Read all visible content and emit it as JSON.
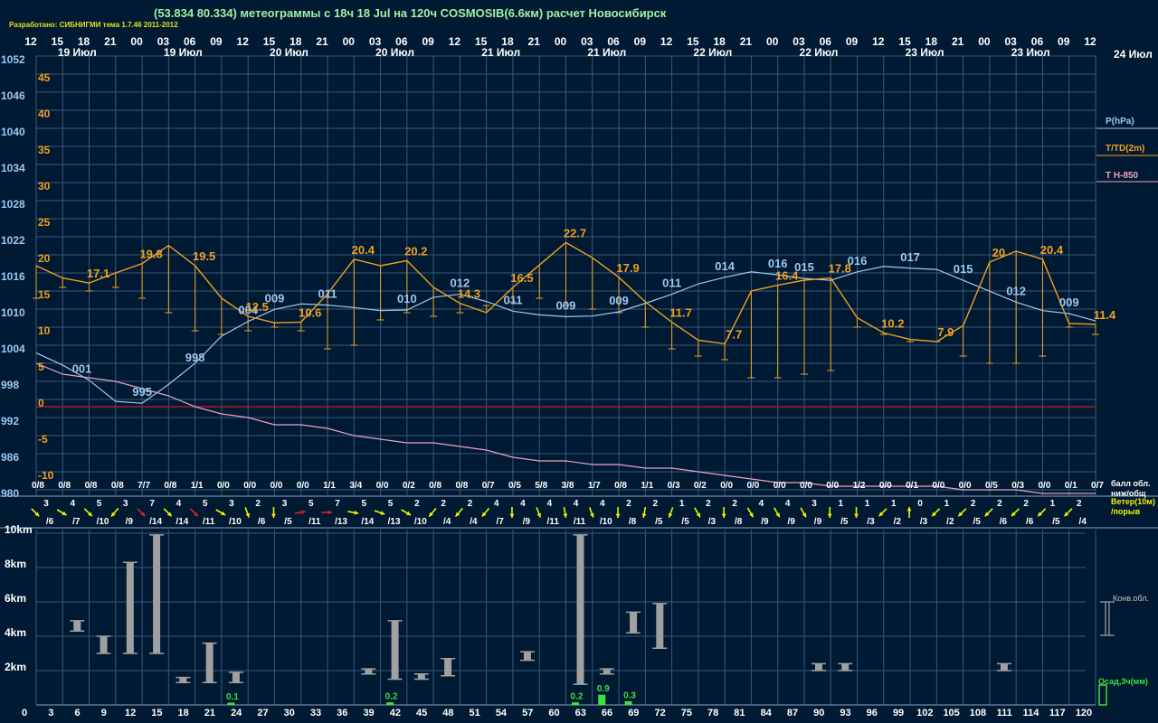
{
  "header": {
    "title": "(53.834 80.334) метеограммы с  18ч 18 Jul на 120ч COSMOSIB(6.6км) расчет Новосибирск",
    "credit": "Разработано: СИБНИГМИ тема 1.7.46 2011-2012"
  },
  "colors": {
    "background": "#001a33",
    "grid": "#3a5878",
    "pressure": "#9ec8f0",
    "temperature": "#f0a020",
    "t850": "#f0a0c0",
    "zero_line": "#c02020",
    "wind": "#f0f000",
    "wind_strong": "#e02020",
    "cloud": "#a0a0a0",
    "precip": "#40e040"
  },
  "time_axis": {
    "hours": [
      "12",
      "15",
      "18",
      "21",
      "00",
      "03",
      "06",
      "09",
      "12",
      "15",
      "18",
      "21",
      "00",
      "03",
      "06",
      "09",
      "12",
      "15",
      "18",
      "21",
      "00",
      "03",
      "06",
      "09",
      "12",
      "15",
      "18",
      "21",
      "00",
      "03",
      "06",
      "09",
      "12",
      "15",
      "18",
      "21",
      "00",
      "03",
      "06",
      "09",
      "12"
    ],
    "dates": [
      "19 Июл",
      "19 Июл",
      "20 Июл",
      "20 Июл",
      "21 Июл",
      "21 Июл",
      "22 Июл",
      "22 Июл",
      "23 Июл",
      "23 Июл"
    ],
    "right_date": "24 Июл",
    "lead_hours": [
      "0",
      "3",
      "6",
      "9",
      "12",
      "15",
      "18",
      "21",
      "24",
      "27",
      "30",
      "33",
      "36",
      "39",
      "42",
      "45",
      "48",
      "51",
      "54",
      "57",
      "60",
      "63",
      "66",
      "69",
      "72",
      "75",
      "78",
      "81",
      "84",
      "87",
      "90",
      "93",
      "96",
      "99",
      "102",
      "105",
      "108",
      "111",
      "114",
      "117",
      "120"
    ]
  },
  "pressure_axis": [
    "1052",
    "1046",
    "1040",
    "1034",
    "1028",
    "1022",
    "1016",
    "1010",
    "1004",
    "998",
    "992",
    "986",
    "980"
  ],
  "temp_axis": [
    "45",
    "40",
    "35",
    "30",
    "25",
    "20",
    "15",
    "10",
    "5",
    "0",
    "-5",
    "-10"
  ],
  "height_axis": [
    "10km",
    "8km",
    "6km",
    "4km",
    "2km"
  ],
  "legend": {
    "pressure": "P(hPa)",
    "temperature": "T/TD(2m)",
    "t850": "T H-850",
    "cloud_label": "балл обл.\nниж/общ",
    "wind_label": "Ветер(10м)\n/порыв",
    "conv_label": "Конв.обл.",
    "precip_label": "Осад,3ч(мм)"
  },
  "chart_data": {
    "type": "line",
    "lead_hours": [
      0,
      3,
      6,
      9,
      12,
      15,
      18,
      21,
      24,
      27,
      30,
      33,
      36,
      39,
      42,
      45,
      48,
      51,
      54,
      57,
      60,
      63,
      66,
      69,
      72,
      75,
      78,
      81,
      84,
      87,
      90,
      93,
      96,
      99,
      102,
      105,
      108,
      111,
      114,
      117,
      120
    ],
    "pressure_hpa": [
      1003.2,
      1001.2,
      998.7,
      995.2,
      994.9,
      998.0,
      1001.5,
      1006.0,
      1008.4,
      1010.4,
      1011.3,
      1011.1,
      1010.7,
      1010.2,
      1010.3,
      1012.4,
      1012.9,
      1011.7,
      1010.1,
      1009.5,
      1009.2,
      1009.3,
      1010.0,
      1011.4,
      1012.9,
      1014.6,
      1015.7,
      1016.6,
      1016.1,
      1015.5,
      1015.2,
      1016.6,
      1017.5,
      1017.2,
      1017.0,
      1015.2,
      1013.4,
      1011.6,
      1010.2,
      1009.7,
      1008.5
    ],
    "t2m": [
      19.5,
      17.8,
      17.1,
      18.5,
      19.8,
      22.3,
      19.5,
      15.0,
      12.5,
      11.6,
      11.7,
      15.6,
      20.4,
      19.5,
      20.2,
      16.5,
      14.3,
      13.0,
      16.5,
      19.6,
      22.7,
      20.6,
      17.9,
      14.5,
      11.7,
      9.2,
      8.7,
      16.0,
      16.8,
      17.5,
      17.8,
      12.3,
      10.2,
      9.3,
      9.0,
      11.2,
      20.0,
      21.5,
      20.4,
      11.5,
      11.4
    ],
    "td2m": [
      15.0,
      16.5,
      16.0,
      16.5,
      15.0,
      13.0,
      10.5,
      10.0,
      10.5,
      11.0,
      10.5,
      8.0,
      8.5,
      12.0,
      13.0,
      12.5,
      13.0,
      14.0,
      14.5,
      15.0,
      14.0,
      13.5,
      13.0,
      11.0,
      8.0,
      7.0,
      6.5,
      4.0,
      4.0,
      4.5,
      5.0,
      11.0,
      10.0,
      9.0,
      9.0,
      7.0,
      6.0,
      6.0,
      7.0,
      11.0,
      10.0
    ],
    "t850": [
      6.0,
      4.5,
      4.0,
      3.5,
      2.5,
      1.5,
      0.0,
      -1.0,
      -1.5,
      -2.5,
      -2.5,
      -3.0,
      -4.0,
      -4.5,
      -5.0,
      -5.0,
      -5.5,
      -6.0,
      -7.0,
      -7.5,
      -7.5,
      -8.0,
      -8.0,
      -8.5,
      -8.5,
      -9.0,
      -9.5,
      -10.0,
      -10.5,
      -10.5,
      -11.0,
      -11.0,
      -11.0,
      -11.0,
      -11.0,
      -11.5,
      -11.5,
      -11.5,
      -12.0,
      -12.0,
      -12.0
    ],
    "pressure_labels": [
      {
        "h": 3,
        "text": "001"
      },
      {
        "h": 12,
        "text": "995"
      },
      {
        "h": 21,
        "text": "998"
      },
      {
        "h": 30,
        "text": "004"
      },
      {
        "h": 39,
        "text": "009"
      },
      {
        "h": 45,
        "text": "011"
      },
      {
        "h": 54,
        "text": "010"
      },
      {
        "h": 63,
        "text": "012"
      },
      {
        "h": 69,
        "text": "011"
      },
      {
        "h": 84,
        "text": "009"
      },
      {
        "h": 93,
        "text": "009"
      },
      {
        "h": 102,
        "text": "011"
      },
      {
        "h": 111,
        "text": "014"
      },
      {
        "h": 117,
        "text": "016"
      },
      {
        "h": 123,
        "text": "015"
      },
      {
        "h": 129,
        "text": "016"
      },
      {
        "h": 135,
        "text": "017"
      },
      {
        "h": 141,
        "text": "015"
      },
      {
        "h": 150,
        "text": "012"
      },
      {
        "h": 159,
        "text": "009"
      }
    ],
    "temp_labels": [
      {
        "i": 2,
        "text": "17.1"
      },
      {
        "i": 4,
        "text": "19.8"
      },
      {
        "i": 6,
        "text": "19.5"
      },
      {
        "i": 8,
        "text": "12.5"
      },
      {
        "i": 10,
        "text": "10.6"
      },
      {
        "i": 12,
        "text": "20.4"
      },
      {
        "i": 14,
        "text": "20.2"
      },
      {
        "i": 16,
        "text": "14.3"
      },
      {
        "i": 18,
        "text": "16.5"
      },
      {
        "i": 20,
        "text": "22.7"
      },
      {
        "i": 22,
        "text": "17.9"
      },
      {
        "i": 24,
        "text": "11.7"
      },
      {
        "i": 26,
        "text": "7.7"
      },
      {
        "i": 28,
        "text": "16.4"
      },
      {
        "i": 30,
        "text": "17.8"
      },
      {
        "i": 32,
        "text": "10.2"
      },
      {
        "i": 34,
        "text": "7.9"
      },
      {
        "i": 36,
        "text": "20"
      },
      {
        "i": 38,
        "text": "20.4"
      },
      {
        "i": 40,
        "text": "11.4"
      }
    ],
    "cloudiness": [
      "0/8",
      "0/8",
      "0/8",
      "0/8",
      "7/7",
      "0/8",
      "1/1",
      "0/0",
      "0/0",
      "0/0",
      "0/0",
      "1/1",
      "3/4",
      "0/0",
      "0/2",
      "0/8",
      "0/8",
      "0/7",
      "0/5",
      "5/8",
      "3/8",
      "1/7",
      "0/8",
      "1/1",
      "0/3",
      "0/2",
      "0/0",
      "0/0",
      "0/0",
      "0/0",
      "0/0",
      "1/2",
      "0/0",
      "0/1",
      "0/0",
      "0/0",
      "0/5",
      "0/3",
      "0/0",
      "0/1",
      "0/7"
    ],
    "wind": [
      {
        "s": "3",
        "g": "/6",
        "dir": 135,
        "strong": false
      },
      {
        "s": "4",
        "g": "/7",
        "dir": 120,
        "strong": false
      },
      {
        "s": "5",
        "g": "/10",
        "dir": 135,
        "strong": false
      },
      {
        "s": "3",
        "g": "/9",
        "dir": 220,
        "strong": false
      },
      {
        "s": "7",
        "g": "/14",
        "dir": 135,
        "strong": true
      },
      {
        "s": "4",
        "g": "/14",
        "dir": 135,
        "strong": false
      },
      {
        "s": "5",
        "g": "/11",
        "dir": 135,
        "strong": true
      },
      {
        "s": "3",
        "g": "/10",
        "dir": 120,
        "strong": false
      },
      {
        "s": "2",
        "g": "/6",
        "dir": 160,
        "strong": false
      },
      {
        "s": "3",
        "g": "/5",
        "dir": 180,
        "strong": false
      },
      {
        "s": "5",
        "g": "/11",
        "dir": 80,
        "strong": true
      },
      {
        "s": "7",
        "g": "/13",
        "dir": 90,
        "strong": true
      },
      {
        "s": "5",
        "g": "/14",
        "dir": 100,
        "strong": false
      },
      {
        "s": "5",
        "g": "/13",
        "dir": 110,
        "strong": false
      },
      {
        "s": "2",
        "g": "/10",
        "dir": 120,
        "strong": false
      },
      {
        "s": "2",
        "g": "/4",
        "dir": 220,
        "strong": false
      },
      {
        "s": "2",
        "g": "/4",
        "dir": 220,
        "strong": false
      },
      {
        "s": "4",
        "g": "/7",
        "dir": 220,
        "strong": false
      },
      {
        "s": "4",
        "g": "/9",
        "dir": 180,
        "strong": false
      },
      {
        "s": "4",
        "g": "/11",
        "dir": 160,
        "strong": false
      },
      {
        "s": "4",
        "g": "/11",
        "dir": 170,
        "strong": false
      },
      {
        "s": "4",
        "g": "/10",
        "dir": 160,
        "strong": false
      },
      {
        "s": "2",
        "g": "/8",
        "dir": 180,
        "strong": false
      },
      {
        "s": "2",
        "g": "/5",
        "dir": 190,
        "strong": false
      },
      {
        "s": "1",
        "g": "/5",
        "dir": 200,
        "strong": false
      },
      {
        "s": "2",
        "g": "/3",
        "dir": 150,
        "strong": false
      },
      {
        "s": "2",
        "g": "/8",
        "dir": 180,
        "strong": false
      },
      {
        "s": "4",
        "g": "/9",
        "dir": 150,
        "strong": false
      },
      {
        "s": "4",
        "g": "/9",
        "dir": 150,
        "strong": false
      },
      {
        "s": "3",
        "g": "/9",
        "dir": 150,
        "strong": false
      },
      {
        "s": "1",
        "g": "/5",
        "dir": 180,
        "strong": false
      },
      {
        "s": "1",
        "g": "/3",
        "dir": 180,
        "strong": false
      },
      {
        "s": "1",
        "g": "/2",
        "dir": 225,
        "strong": false
      },
      {
        "s": "0",
        "g": "/3",
        "dir": 0,
        "strong": false
      },
      {
        "s": "1",
        "g": "/2",
        "dir": 225,
        "strong": false
      },
      {
        "s": "2",
        "g": "/5",
        "dir": 225,
        "strong": false
      },
      {
        "s": "2",
        "g": "/6",
        "dir": 225,
        "strong": false
      },
      {
        "s": "2",
        "g": "/6",
        "dir": 225,
        "strong": false
      },
      {
        "s": "1",
        "g": "/5",
        "dir": 225,
        "strong": false
      },
      {
        "s": "2",
        "g": "/4",
        "dir": 225,
        "strong": false
      }
    ],
    "conv_clouds": [
      {
        "h": 3,
        "base": 4.3,
        "top": 4.9
      },
      {
        "h": 6,
        "base": 3.0,
        "top": 4.0
      },
      {
        "h": 9,
        "base": 3.0,
        "top": 8.3
      },
      {
        "h": 12,
        "base": 3.0,
        "top": 9.9
      },
      {
        "h": 15,
        "base": 1.3,
        "top": 1.6
      },
      {
        "h": 18,
        "base": 1.3,
        "top": 3.6
      },
      {
        "h": 21,
        "base": 1.3,
        "top": 1.9
      },
      {
        "h": 36,
        "base": 1.8,
        "top": 2.1
      },
      {
        "h": 39,
        "base": 1.5,
        "top": 4.9
      },
      {
        "h": 42,
        "base": 1.5,
        "top": 1.8
      },
      {
        "h": 45,
        "base": 1.7,
        "top": 2.7
      },
      {
        "h": 54,
        "base": 2.6,
        "top": 3.1
      },
      {
        "h": 60,
        "base": 1.2,
        "top": 9.9
      },
      {
        "h": 63,
        "base": 1.8,
        "top": 2.1
      },
      {
        "h": 66,
        "base": 4.2,
        "top": 5.4
      },
      {
        "h": 69,
        "base": 3.3,
        "top": 5.9
      },
      {
        "h": 87,
        "base": 2.0,
        "top": 2.4
      },
      {
        "h": 90,
        "base": 2.0,
        "top": 2.4
      },
      {
        "h": 108,
        "base": 2.0,
        "top": 2.4
      }
    ],
    "precip": [
      {
        "h": 21,
        "v": 0.1,
        "label": "0.1"
      },
      {
        "h": 39,
        "v": 0.2,
        "label": "0.2"
      },
      {
        "h": 60,
        "v": 0.2,
        "label": "0.2"
      },
      {
        "h": 63,
        "v": 0.9,
        "label": "0.9"
      },
      {
        "h": 66,
        "v": 0.3,
        "label": "0.3"
      }
    ]
  }
}
